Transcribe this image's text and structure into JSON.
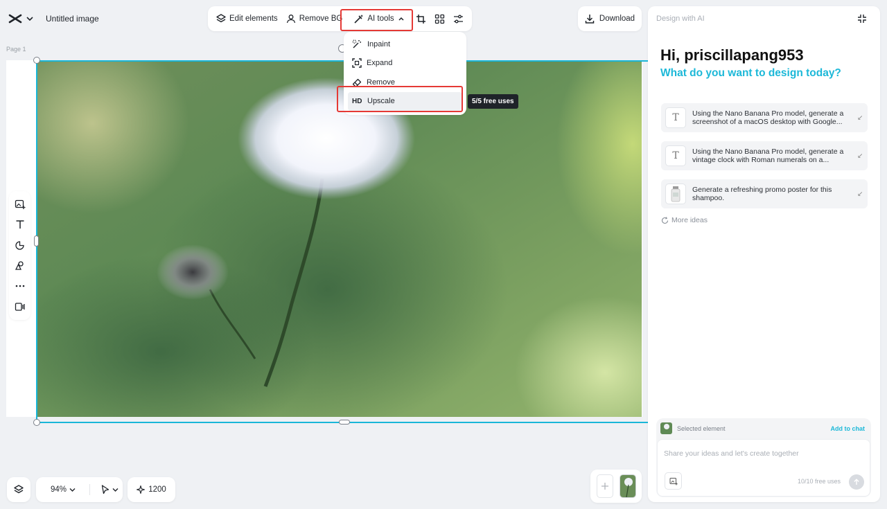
{
  "header": {
    "doc_title": "Untitled image",
    "logo_icon": "capcut-logo-icon",
    "menu_chevron_icon": "chevron-down-icon"
  },
  "toolbar": {
    "edit_elements": "Edit elements",
    "remove_bg": "Remove BG",
    "ai_tools": "AI tools",
    "download": "Download"
  },
  "ai_menu": {
    "items": [
      {
        "icon": "inpaint-icon",
        "label": "Inpaint"
      },
      {
        "icon": "expand-icon",
        "label": "Expand"
      },
      {
        "icon": "eraser-icon",
        "label": "Remove"
      },
      {
        "icon": "HD",
        "label": "Upscale"
      }
    ],
    "tooltip": "5/5 free uses"
  },
  "canvas": {
    "page_label": "Page 1"
  },
  "bottom": {
    "zoom": "94%",
    "credits": "1200"
  },
  "panel": {
    "title": "Design with AI",
    "greeting": "Hi, priscillapang953",
    "subtitle": "What do you want to design today?",
    "suggestions": [
      {
        "icon": "text-icon",
        "text": "Using the Nano Banana Pro model, generate a screenshot of a macOS desktop with Google..."
      },
      {
        "icon": "text-icon",
        "text": "Using the Nano Banana Pro model, generate a vintage clock with Roman numerals on a..."
      },
      {
        "icon": "shampoo-thumbnail",
        "text": "Generate a refreshing promo poster for this shampoo."
      }
    ],
    "more_ideas": "More ideas",
    "selected_element": "Selected element",
    "add_to_chat": "Add to chat",
    "chat_placeholder": "Share your ideas and let's create together",
    "free_uses": "10/10 free uses"
  },
  "colors": {
    "accent": "#1cb8d8",
    "highlight": "#e53935",
    "background": "#eff1f4"
  }
}
